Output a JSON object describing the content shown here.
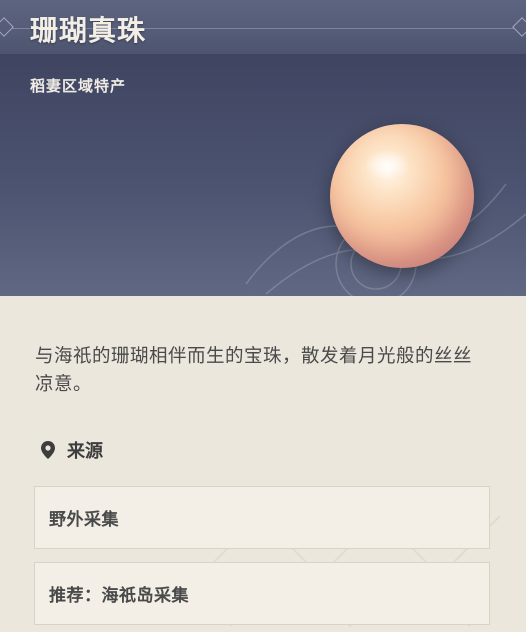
{
  "item": {
    "name": "珊瑚真珠",
    "region_specialty": "稻妻区域特产",
    "description": "与海祇的珊瑚相伴而生的宝珠，散发着月光般的丝丝凉意。"
  },
  "source": {
    "header": "来源",
    "entries": [
      "野外采集",
      "推荐：海祇岛采集"
    ]
  },
  "icons": {
    "pin": "location-pin-icon",
    "item_image": "coral-pearl-image"
  },
  "colors": {
    "title_bar": "#555c78",
    "hero_bg": "#4c5370",
    "body_bg": "#ece7dd",
    "text": "#4a4a4a"
  }
}
